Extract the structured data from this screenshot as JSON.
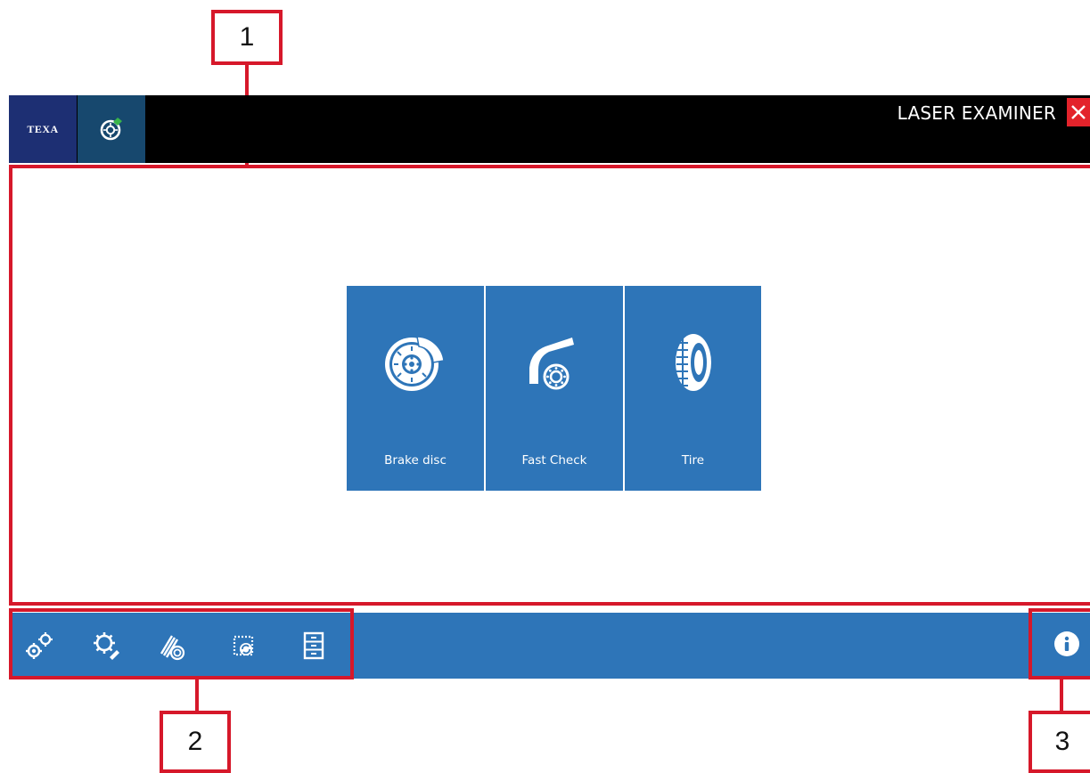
{
  "window": {
    "logo_text": "TEXA",
    "title": "LASER EXAMINER",
    "app_icon": "wheel-check-icon",
    "close_icon": "close-icon"
  },
  "tiles": [
    {
      "label": "Brake disc",
      "icon": "brake-disc-icon"
    },
    {
      "label": "Fast Check",
      "icon": "fast-check-icon"
    },
    {
      "label": "Tire",
      "icon": "tire-icon"
    }
  ],
  "toolbar": {
    "buttons": [
      {
        "icon": "settings-gears-icon"
      },
      {
        "icon": "gear-wrench-icon"
      },
      {
        "icon": "calibration-icon"
      },
      {
        "icon": "update-chip-icon"
      },
      {
        "icon": "archive-cabinet-icon"
      }
    ],
    "info_icon": "info-icon"
  },
  "callouts": {
    "c1": "1",
    "c2": "2",
    "c3": "3"
  },
  "colors": {
    "accent_blue": "#2e75b8",
    "topbar": "#000000",
    "logo_bg": "#1d2f73",
    "close_red": "#e3232b",
    "callout_red": "#d6182a"
  }
}
